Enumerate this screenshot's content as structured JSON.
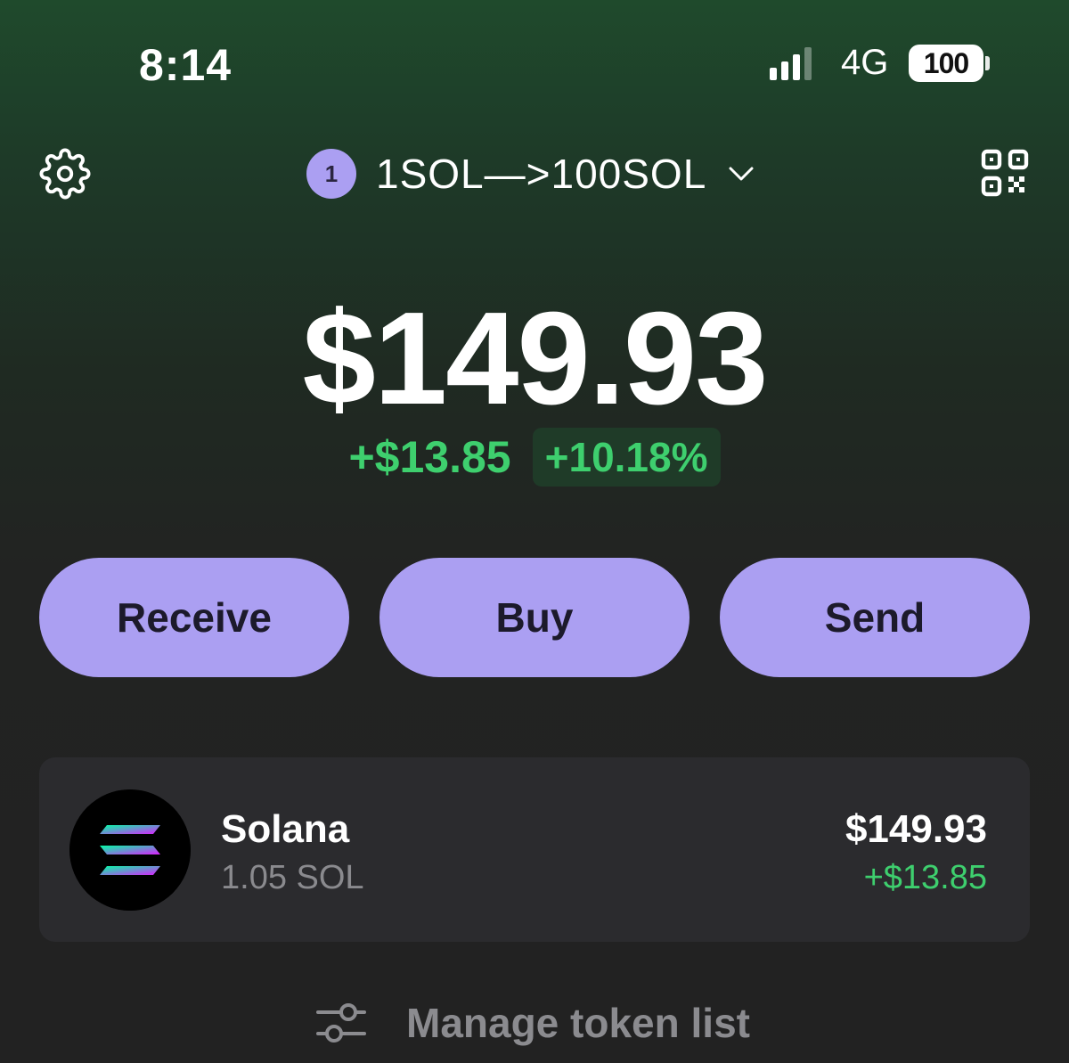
{
  "status_bar": {
    "time": "8:14",
    "network": "4G",
    "battery": "100"
  },
  "header": {
    "settings_icon": "gear-icon",
    "account_index": "1",
    "account_name": "1SOL—>100SOL",
    "dropdown_icon": "chevron-down-icon",
    "qr_icon": "qr-code-icon"
  },
  "balance": {
    "total": "$149.93",
    "change_abs": "+$13.85",
    "change_pct": "+10.18%"
  },
  "actions": {
    "receive": "Receive",
    "buy": "Buy",
    "send": "Send"
  },
  "tokens": [
    {
      "name": "Solana",
      "amount": "1.05 SOL",
      "value": "$149.93",
      "change": "+$13.85",
      "icon": "solana-logo"
    }
  ],
  "manage": {
    "icon": "sliders-icon",
    "label": "Manage token list"
  },
  "colors": {
    "accent": "#ab9ff2",
    "positive": "#3ecf6e",
    "card": "#2b2b2e",
    "muted": "#8b8b8f"
  }
}
